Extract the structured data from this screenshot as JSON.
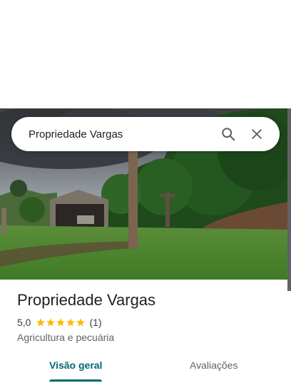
{
  "search": {
    "query": "Propriedade Vargas"
  },
  "icons": {
    "search": "search-icon",
    "close": "close-icon",
    "star": "star-icon"
  },
  "place": {
    "name": "Propriedade Vargas",
    "rating": "5,0",
    "stars": 5,
    "review_count": "(1)",
    "category": "Agricultura e pecuária"
  },
  "tabs": [
    {
      "label": "Visão geral",
      "selected": true
    },
    {
      "label": "Avaliações",
      "selected": false
    }
  ],
  "colors": {
    "accent": "#01696e",
    "star": "#fbbc04",
    "text": "#202124",
    "muted": "#5f6368"
  }
}
